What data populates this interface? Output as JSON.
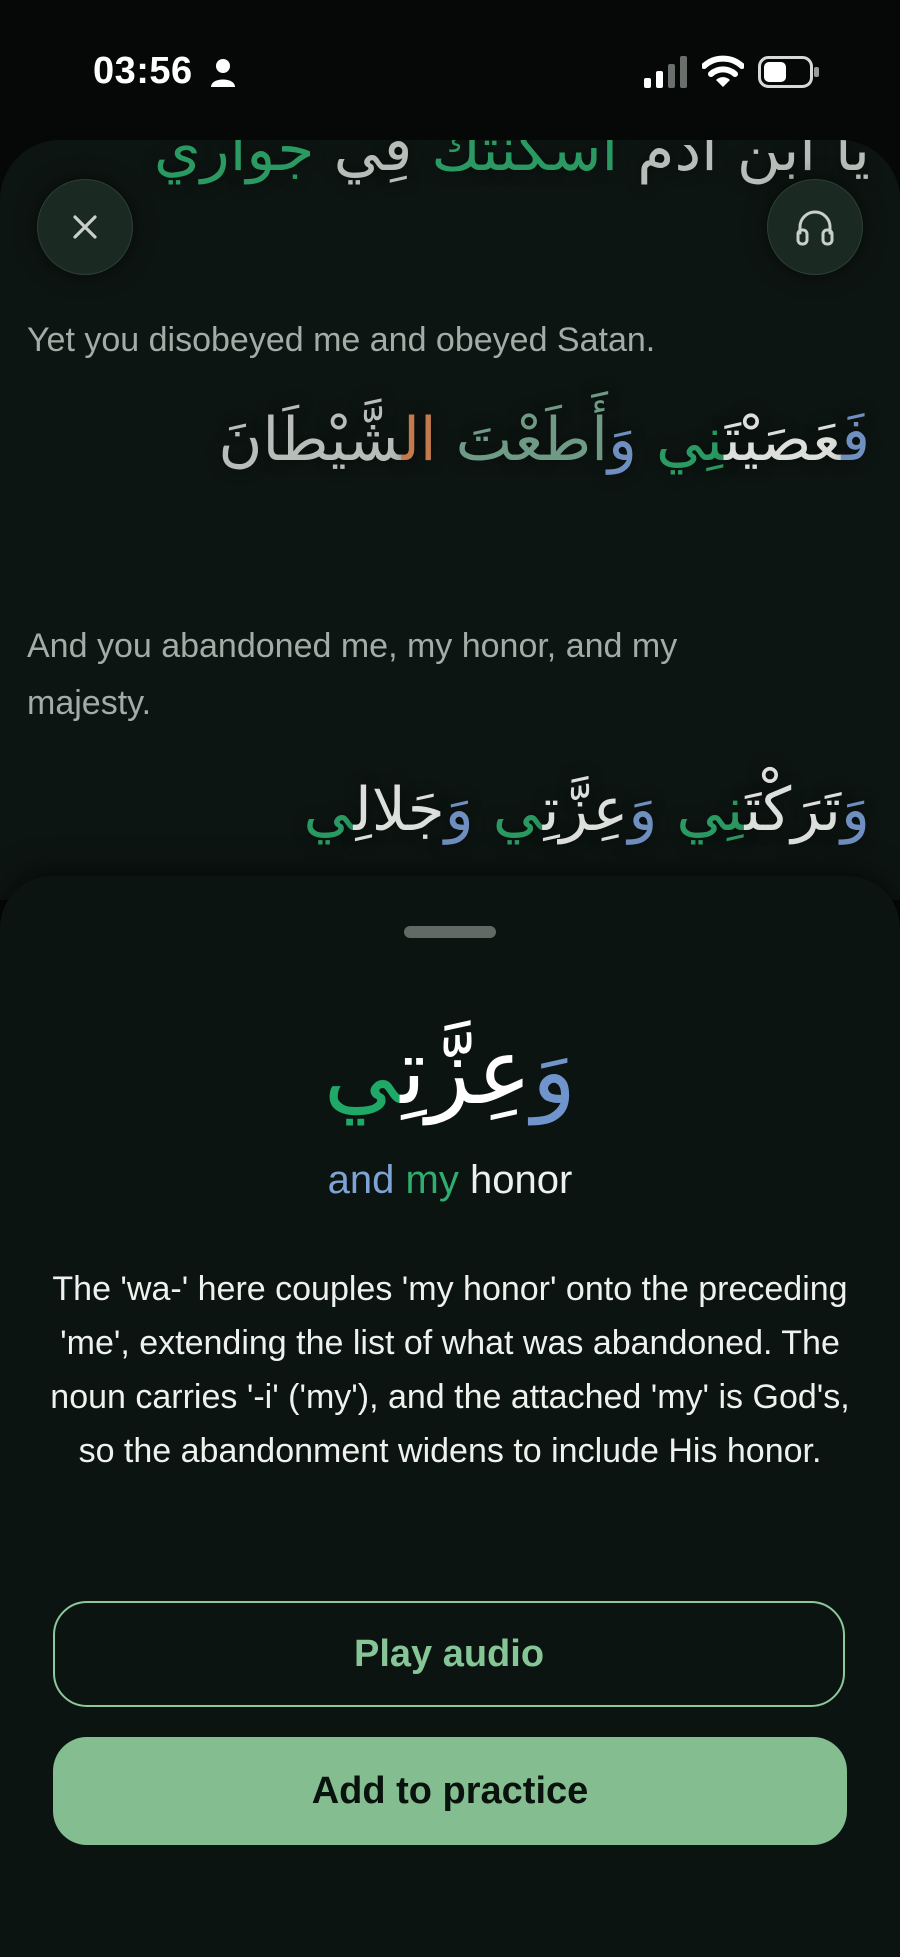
{
  "status_bar": {
    "time": "03:56"
  },
  "reader": {
    "line0_arabic_parts": [
      "يا ابن آدم ",
      "اسكنتك",
      " فِي ",
      "جواري"
    ],
    "line1_translation": "Yet you disobeyed me and obeyed Satan.",
    "line1_arabic_parts": [
      "فَ",
      "عَصَيْتَ",
      "نِي",
      " وَ",
      "أَطَعْتَ",
      " ال",
      "شَّيْطَانَ"
    ],
    "line2_translation": "And you abandoned me, my honor, and my majesty.",
    "line2_arabic_parts": [
      "وَ",
      "تَرَكْتَ",
      "نِي",
      " وَ",
      "عِزَّتِ",
      "ي",
      " وَ",
      "جَلالِ",
      "ي"
    ]
  },
  "sheet": {
    "word_arabic_parts": [
      "وَ",
      "عِزَّتِ",
      "ي"
    ],
    "gloss_parts": [
      "and",
      "my",
      "honor"
    ],
    "explanation": "The 'wa-' here couples 'my honor' onto the preceding 'me', extending the list of what was abandoned. The noun carries '-i' ('my'), and the attached 'my' is God's, so the abandonment widens to include His honor.",
    "play_audio_label": "Play audio",
    "add_to_practice_label": "Add to practice"
  },
  "colors": {
    "accent_green": "#84bd90",
    "conjunction_blue": "#6f95cc",
    "pronoun_green": "#1fa866",
    "background": "#050807"
  },
  "icons": {
    "close": "close-icon",
    "audio": "headphones-icon"
  }
}
